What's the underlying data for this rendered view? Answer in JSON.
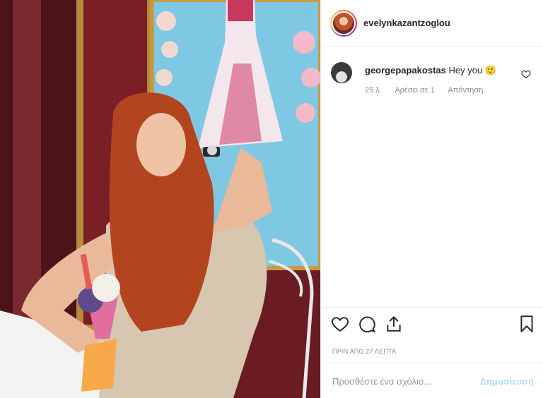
{
  "post": {
    "author": "evelynkazantzoglou",
    "timestamp": "ΠΡΙΝ ΑΠΟ 27 ΛΕΠΤΑ"
  },
  "comments": [
    {
      "username": "georgepapakostas",
      "text": "Hey you 🙂",
      "age": "25 λ.",
      "likes": "Αρέσει σε 1",
      "reply": "Απάντηση"
    }
  ],
  "add_comment": {
    "placeholder": "Προσθέστε ένα σχόλιο...",
    "post_label": "Δημοσίευση"
  },
  "icons": {
    "like": "heart-icon",
    "comment": "comment-bubble-icon",
    "share": "share-icon",
    "save": "bookmark-icon"
  },
  "colors": {
    "text": "#262626",
    "muted": "#8e8e8e",
    "post_disabled": "#b3dbff",
    "border": "#efefef"
  }
}
